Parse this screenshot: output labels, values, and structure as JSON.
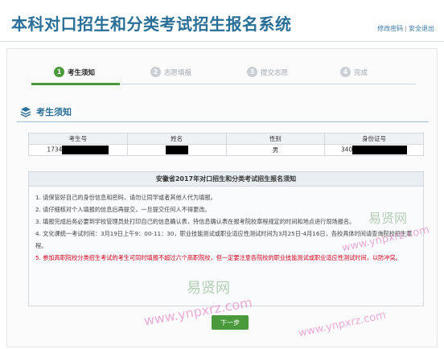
{
  "header": {
    "title": "本科对口招生和分类考试招生报名系统",
    "links": [
      "修改密码",
      "安全退出"
    ],
    "separator": "|"
  },
  "steps": [
    {
      "num": "1",
      "label": "考生须知",
      "active": true
    },
    {
      "num": "2",
      "label": "志愿填报",
      "active": false
    },
    {
      "num": "3",
      "label": "提交志愿",
      "active": false
    },
    {
      "num": "4",
      "label": "完成",
      "active": false
    }
  ],
  "section": {
    "title": "考生须知",
    "icon": "stack-icon"
  },
  "info_table": {
    "headers": [
      "考生号",
      "姓名",
      "性别",
      "身份证号"
    ],
    "row": {
      "exam_no": "1734",
      "name": "",
      "gender": "男",
      "id_no": "340"
    }
  },
  "notice": {
    "title": "安徽省2017年对口招生和分类考试招生报名须知",
    "items": [
      "1. 请保管好自己的身份信息和密码，请勿让同学或者其他人代为填报。",
      "2. 请仔细核对个人填报的信息后再提交，一旦提交任何人不得更改。",
      "3. 填报完成后务必要到学校管理员处打印自己的信息确认表，持信息确认表在报考院校章程规定的时间和地点进行现场报名。",
      "4. 文化课统一考试时间：3月19日上午9：00-11：30，职业技能测试或职业适应性测试时间为3月25日-4月16日，各校具体时间请查询院校招生章程。",
      "5. 参加高职院校分类招生考试的考生可同时填报不超过六个高职院校，但一定要注意各院校的职业技能测试或职业适应性测试时间，以防冲突。"
    ]
  },
  "buttons": {
    "next": "下一步"
  },
  "watermarks": {
    "cn": "易贤网",
    "url": "www.ynpxrz.com"
  },
  "colors": {
    "brand": "#2a6f97",
    "active": "#4a9a3c",
    "warning": "#d0021b"
  }
}
